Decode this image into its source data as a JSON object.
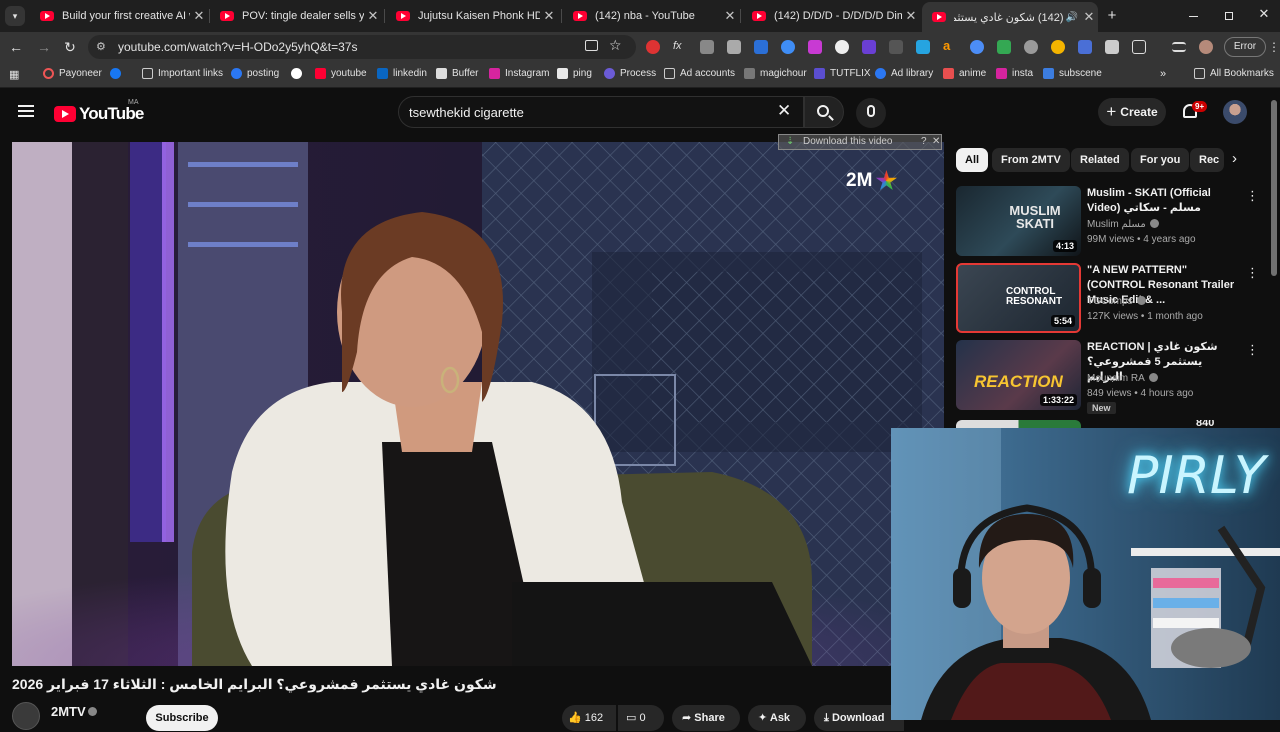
{
  "tabs": [
    {
      "title": "Build your first creative AI work"
    },
    {
      "title": "POV: tingle dealer sells you $25"
    },
    {
      "title": "Jujutsu Kaisen Phonk HD - YouT"
    },
    {
      "title": "(142) nba - YouTube"
    },
    {
      "title": "(142) D/D/D - D/D/D/D Dimens"
    },
    {
      "title": "(142) شكون غادي يستثمر فمشروعي",
      "active": true
    }
  ],
  "address": {
    "url": "youtube.com/watch?v=H-ODo2y5yhQ&t=37s"
  },
  "profile_error": "Error",
  "bookmarks": [
    "Payoneer",
    "Important links",
    "posting",
    "youtube",
    "linkedin",
    "Buffer",
    "Instagram",
    "ping",
    "Process",
    "Ad accounts",
    "magichour",
    "TUTFLIX",
    "Ad library",
    "anime",
    "insta",
    "subscene"
  ],
  "all_bookmarks": "All Bookmarks",
  "youtube": {
    "logo_text": "YouTube",
    "country_code": "MA",
    "search_query": "tsewthekid cigarette",
    "create_label": "Create",
    "notification_count": "9+"
  },
  "player": {
    "download_overlay": "Download this video",
    "broadcaster_logo": "2M",
    "streamer_sign": "PIRLY"
  },
  "video": {
    "title": "شكون غادي يستثمر فمشروعي؟ البرايم الخامس : الثلاثاء 17 فبراير 2026",
    "channel": "2MTV",
    "subscribe_label": "Subscribe",
    "likes": "162",
    "comments": "0",
    "share_label": "Share",
    "ask_label": "Ask",
    "download_label": "Download"
  },
  "chips": [
    "All",
    "From 2MTV",
    "Related",
    "For you",
    "Rec"
  ],
  "related": [
    {
      "title": "Muslim - SKATI (Official Video) مسلم - سكاتي",
      "channel": "Muslim مسلم",
      "meta": "99M views • 4 years ago",
      "duration": "4:13",
      "thumb_text": "MUSLIM SKATI"
    },
    {
      "title": "\"A NEW PATTERN\" (CONTROL Resonant Trailer Music Edit & ...",
      "channel": "TGComps",
      "meta": "127K views • 1 month ago",
      "duration": "5:54",
      "thumb_text": "CONTROL RESONANT"
    },
    {
      "title": "REACTION | شكون غادي يستثمر 5 فمشروعي؟ البرايم",
      "channel": "Mounaim RA",
      "meta": "849 views • 4 hours ago",
      "duration": "1:33:22",
      "badge": "New",
      "thumb_text": "REACTION"
    }
  ],
  "partial_related": {
    "title": "840"
  }
}
